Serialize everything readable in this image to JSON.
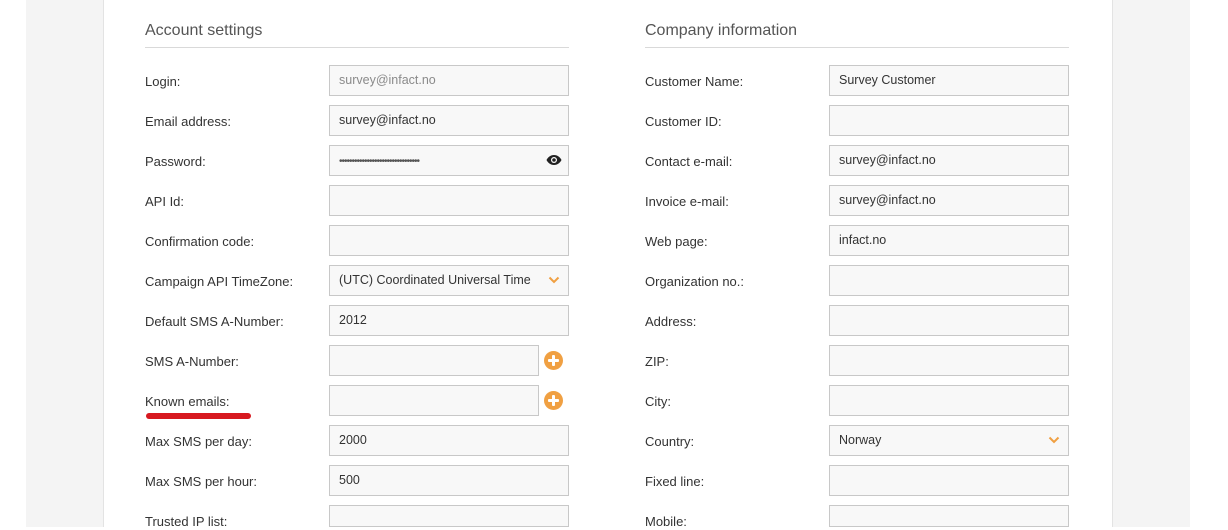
{
  "account": {
    "title": "Account settings",
    "fields": [
      {
        "label": "Login:",
        "value": "survey@infact.no"
      },
      {
        "label": "Email address:",
        "value": "survey@infact.no"
      },
      {
        "label": "Password:",
        "value": "••••••••••••••••••••••••••••••••"
      },
      {
        "label": "API Id:",
        "value": ""
      },
      {
        "label": "Confirmation code:",
        "value": ""
      },
      {
        "label": "Campaign API TimeZone:",
        "value": "(UTC) Coordinated Universal Time"
      },
      {
        "label": "Default SMS A-Number:",
        "value": "2012"
      },
      {
        "label": "SMS A-Number:",
        "value": ""
      },
      {
        "label": "Known emails:",
        "value": ""
      },
      {
        "label": "Max SMS per day:",
        "value": "2000"
      },
      {
        "label": "Max SMS per hour:",
        "value": "500"
      },
      {
        "label": "Trusted IP list:",
        "value": ""
      }
    ]
  },
  "company": {
    "title": "Company information",
    "fields": [
      {
        "label": "Customer Name:",
        "value": "Survey Customer"
      },
      {
        "label": "Customer ID:",
        "value": ""
      },
      {
        "label": "Contact e-mail:",
        "value": "survey@infact.no"
      },
      {
        "label": "Invoice e-mail:",
        "value": "survey@infact.no"
      },
      {
        "label": "Web page:",
        "value": "infact.no"
      },
      {
        "label": "Organization no.:",
        "value": ""
      },
      {
        "label": "Address:",
        "value": ""
      },
      {
        "label": "ZIP:",
        "value": ""
      },
      {
        "label": "City:",
        "value": ""
      },
      {
        "label": "Country:",
        "value": "Norway"
      },
      {
        "label": "Fixed line:",
        "value": ""
      },
      {
        "label": "Mobile:",
        "value": ""
      }
    ]
  },
  "icons": {
    "password_toggle": "eye-icon",
    "dropdown": "chevron-down-icon",
    "add": "plus-circle-icon"
  },
  "colors": {
    "accent": "#f0a042",
    "annotation": "#d71920"
  }
}
